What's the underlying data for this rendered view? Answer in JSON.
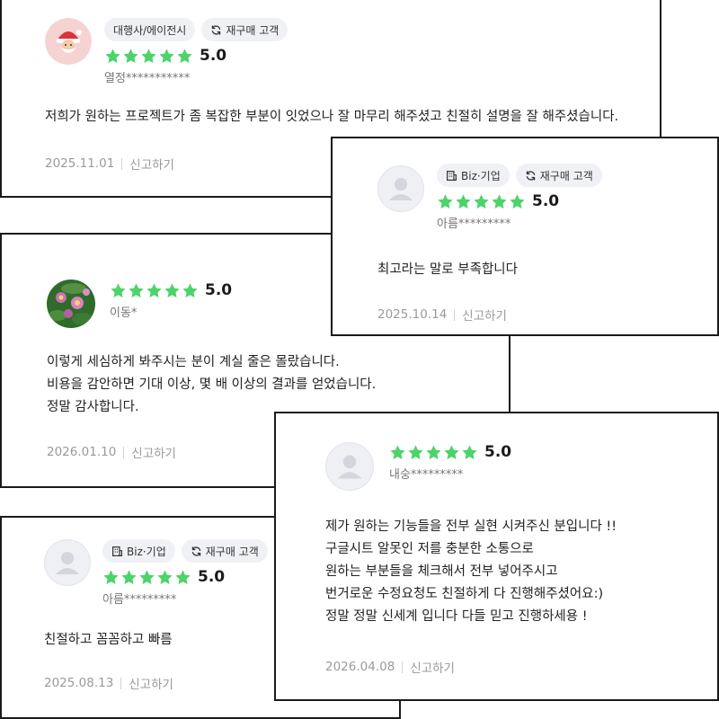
{
  "colors": {
    "star": "#4cd36a",
    "tag_bg": "#f0f1f4",
    "border": "#1a1a1a",
    "muted": "#9a9a9a"
  },
  "reviews": [
    {
      "avatar": "santa-avatar-image",
      "tags": [
        {
          "icon": "none",
          "label": "대행사/에이전시"
        },
        {
          "icon": "refresh-icon",
          "label": "재구매 고객"
        }
      ],
      "rating": 5,
      "score": "5.0",
      "name": "열정***********",
      "lines": [
        "저희가 원하는 프로젝트가 좀 복잡한 부분이 잇었으나 잘 마무리 해주셨고 친절히 설명을 잘 해주셨습니다."
      ],
      "date": "2025.11.01",
      "report": "신고하기"
    },
    {
      "avatar": "default-user-avatar",
      "tags": [
        {
          "icon": "building-icon",
          "label": "Biz·기업"
        },
        {
          "icon": "refresh-icon",
          "label": "재구매 고객"
        }
      ],
      "rating": 5,
      "score": "5.0",
      "name": "아름*********",
      "lines": [
        "최고라는 말로 부족합니다"
      ],
      "date": "2025.10.14",
      "report": "신고하기"
    },
    {
      "avatar": "flower-photo-avatar",
      "tags": [],
      "rating": 5,
      "score": "5.0",
      "name": "이동*",
      "lines": [
        "이렇게 세심하게 봐주시는 분이 계실 줄은 몰랐습니다.",
        "비용을 감안하면 기대 이상, 몇 배 이상의 결과를 얻었습니다.",
        "정말 감사합니다."
      ],
      "date": "2026.01.10",
      "report": "신고하기"
    },
    {
      "avatar": "default-user-avatar",
      "tags": [
        {
          "icon": "building-icon",
          "label": "Biz·기업"
        },
        {
          "icon": "refresh-icon",
          "label": "재구매 고객"
        }
      ],
      "rating": 5,
      "score": "5.0",
      "name": "아름*********",
      "lines": [
        "친절하고 꼼꼼하고 빠름"
      ],
      "date": "2025.08.13",
      "report": "신고하기"
    },
    {
      "avatar": "default-user-avatar",
      "tags": [],
      "rating": 5,
      "score": "5.0",
      "name": "내숭*********",
      "lines": [
        "제가 원하는 기능들을 전부 실현 시켜주신 분입니다 !!",
        "구글시트 알못인 저를 충분한 소통으로",
        "원하는 부분들을 체크해서 전부 넣어주시고",
        "번거로운 수정요청도 친절하게 다 진행해주셨어요:)",
        "정말 정말 신세계 입니다 다들 믿고 진행하세용 !"
      ],
      "date": "2026.04.08",
      "report": "신고하기"
    }
  ]
}
